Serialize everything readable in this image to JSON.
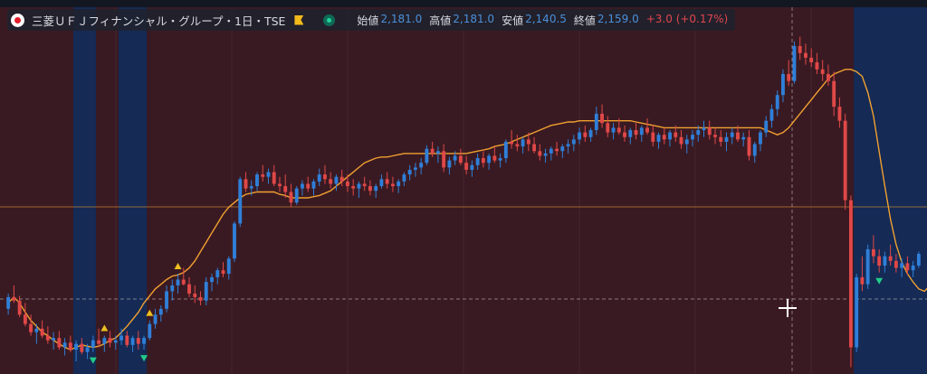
{
  "header": {
    "title": "三菱ＵＦＪフィナンシャル・グループ・1日・TSE",
    "open_label": "始値",
    "open_value": "2,181.0",
    "high_label": "高値",
    "high_value": "2,181.0",
    "low_label": "安値",
    "low_value": "2,140.5",
    "close_label": "終値",
    "close_value": "2,159.0",
    "change": "+3.0 (+0.17%)"
  },
  "colors": {
    "up": "#2f7fd8",
    "down": "#e04848",
    "ma": "#f0a030",
    "bg_red": "#3a1a22",
    "bg_blue": "#152a55",
    "buy_marker": "#f0c020",
    "sell_marker": "#22cc88"
  },
  "icons": [
    "logo-icon",
    "flag-icon",
    "status-dot-icon",
    "crosshair-icon"
  ],
  "chart_data": {
    "type": "candlestick",
    "y_range": [
      1940,
      2220
    ],
    "shading_blue_index_ranges": [
      [
        12,
        15
      ],
      [
        20,
        24
      ],
      [
        150,
        165
      ]
    ],
    "ma": [
      1990,
      1995,
      1990,
      1982,
      1975,
      1970,
      1965,
      1962,
      1958,
      1955,
      1952,
      1950,
      1952,
      1954,
      1953,
      1952,
      1953,
      1955,
      1958,
      1960,
      1965,
      1970,
      1976,
      1982,
      1990,
      1996,
      2002,
      2006,
      2010,
      2013,
      2014,
      2016,
      2020,
      2026,
      2034,
      2042,
      2050,
      2058,
      2066,
      2072,
      2076,
      2080,
      2083,
      2084,
      2085,
      2085,
      2085,
      2085,
      2083,
      2082,
      2080,
      2080,
      2080,
      2080,
      2081,
      2082,
      2084,
      2086,
      2090,
      2094,
      2098,
      2102,
      2106,
      2110,
      2112,
      2114,
      2115,
      2115,
      2116,
      2117,
      2118,
      2118,
      2118,
      2118,
      2118,
      2118,
      2118,
      2118,
      2118,
      2118,
      2118,
      2118,
      2119,
      2120,
      2121,
      2122,
      2124,
      2125,
      2126,
      2128,
      2130,
      2132,
      2134,
      2136,
      2138,
      2140,
      2142,
      2143,
      2144,
      2145,
      2145,
      2146,
      2146,
      2146,
      2146,
      2146,
      2146,
      2146,
      2146,
      2146,
      2146,
      2145,
      2144,
      2143,
      2142,
      2141,
      2140,
      2140,
      2140,
      2140,
      2140,
      2140,
      2140,
      2140,
      2140,
      2140,
      2140,
      2140,
      2140,
      2140,
      2140,
      2140,
      2140,
      2140,
      2138,
      2136,
      2134,
      2136,
      2140,
      2146,
      2152,
      2158,
      2164,
      2170,
      2176,
      2182,
      2186,
      2188,
      2190,
      2190,
      2188,
      2184,
      2170,
      2150,
      2120,
      2090,
      2062,
      2040,
      2025,
      2015,
      2008,
      2002,
      2000,
      2005,
      2012,
      2018
    ],
    "candles": [
      {
        "o": 1985,
        "h": 1998,
        "l": 1980,
        "c": 1995
      },
      {
        "o": 1995,
        "h": 2005,
        "l": 1990,
        "c": 1992
      },
      {
        "o": 1992,
        "h": 1996,
        "l": 1978,
        "c": 1980
      },
      {
        "o": 1980,
        "h": 1990,
        "l": 1970,
        "c": 1972
      },
      {
        "o": 1972,
        "h": 1980,
        "l": 1962,
        "c": 1965
      },
      {
        "o": 1965,
        "h": 1972,
        "l": 1955,
        "c": 1968
      },
      {
        "o": 1968,
        "h": 1975,
        "l": 1960,
        "c": 1962
      },
      {
        "o": 1962,
        "h": 1970,
        "l": 1955,
        "c": 1958
      },
      {
        "o": 1958,
        "h": 1965,
        "l": 1950,
        "c": 1960
      },
      {
        "o": 1960,
        "h": 1966,
        "l": 1950,
        "c": 1952
      },
      {
        "o": 1952,
        "h": 1960,
        "l": 1945,
        "c": 1956
      },
      {
        "o": 1956,
        "h": 1962,
        "l": 1948,
        "c": 1950
      },
      {
        "o": 1950,
        "h": 1958,
        "l": 1940,
        "c": 1955
      },
      {
        "o": 1955,
        "h": 1960,
        "l": 1946,
        "c": 1948
      },
      {
        "o": 1948,
        "h": 1955,
        "l": 1942,
        "c": 1952
      },
      {
        "o": 1952,
        "h": 1962,
        "l": 1948,
        "c": 1958
      },
      {
        "o": 1958,
        "h": 1968,
        "l": 1952,
        "c": 1955
      },
      {
        "o": 1955,
        "h": 1962,
        "l": 1948,
        "c": 1960
      },
      {
        "o": 1960,
        "h": 1966,
        "l": 1952,
        "c": 1956
      },
      {
        "o": 1956,
        "h": 1962,
        "l": 1950,
        "c": 1958
      },
      {
        "o": 1958,
        "h": 1968,
        "l": 1954,
        "c": 1962
      },
      {
        "o": 1962,
        "h": 1966,
        "l": 1952,
        "c": 1954
      },
      {
        "o": 1954,
        "h": 1962,
        "l": 1948,
        "c": 1960
      },
      {
        "o": 1960,
        "h": 1966,
        "l": 1950,
        "c": 1955
      },
      {
        "o": 1955,
        "h": 1962,
        "l": 1950,
        "c": 1960
      },
      {
        "o": 1960,
        "h": 1975,
        "l": 1958,
        "c": 1972
      },
      {
        "o": 1972,
        "h": 1985,
        "l": 1968,
        "c": 1980
      },
      {
        "o": 1980,
        "h": 1988,
        "l": 1974,
        "c": 1985
      },
      {
        "o": 1985,
        "h": 2005,
        "l": 1982,
        "c": 2000
      },
      {
        "o": 2000,
        "h": 2010,
        "l": 1992,
        "c": 2005
      },
      {
        "o": 2005,
        "h": 2015,
        "l": 1998,
        "c": 2010
      },
      {
        "o": 2010,
        "h": 2020,
        "l": 2005,
        "c": 2006
      },
      {
        "o": 2006,
        "h": 2012,
        "l": 1995,
        "c": 1998
      },
      {
        "o": 1998,
        "h": 2005,
        "l": 1990,
        "c": 1995
      },
      {
        "o": 1995,
        "h": 2000,
        "l": 1988,
        "c": 1992
      },
      {
        "o": 1992,
        "h": 2012,
        "l": 1988,
        "c": 2008
      },
      {
        "o": 2008,
        "h": 2015,
        "l": 2000,
        "c": 2012
      },
      {
        "o": 2012,
        "h": 2020,
        "l": 2006,
        "c": 2018
      },
      {
        "o": 2018,
        "h": 2025,
        "l": 2012,
        "c": 2015
      },
      {
        "o": 2015,
        "h": 2030,
        "l": 2010,
        "c": 2028
      },
      {
        "o": 2028,
        "h": 2060,
        "l": 2025,
        "c": 2058
      },
      {
        "o": 2058,
        "h": 2098,
        "l": 2055,
        "c": 2096
      },
      {
        "o": 2096,
        "h": 2102,
        "l": 2085,
        "c": 2088
      },
      {
        "o": 2088,
        "h": 2095,
        "l": 2082,
        "c": 2090
      },
      {
        "o": 2090,
        "h": 2102,
        "l": 2086,
        "c": 2100
      },
      {
        "o": 2100,
        "h": 2108,
        "l": 2094,
        "c": 2098
      },
      {
        "o": 2098,
        "h": 2105,
        "l": 2092,
        "c": 2102
      },
      {
        "o": 2102,
        "h": 2108,
        "l": 2090,
        "c": 2092
      },
      {
        "o": 2092,
        "h": 2098,
        "l": 2085,
        "c": 2090
      },
      {
        "o": 2090,
        "h": 2100,
        "l": 2080,
        "c": 2085
      },
      {
        "o": 2085,
        "h": 2092,
        "l": 2072,
        "c": 2076
      },
      {
        "o": 2076,
        "h": 2090,
        "l": 2074,
        "c": 2088
      },
      {
        "o": 2088,
        "h": 2095,
        "l": 2082,
        "c": 2092
      },
      {
        "o": 2092,
        "h": 2098,
        "l": 2085,
        "c": 2088
      },
      {
        "o": 2088,
        "h": 2096,
        "l": 2082,
        "c": 2094
      },
      {
        "o": 2094,
        "h": 2105,
        "l": 2090,
        "c": 2100
      },
      {
        "o": 2100,
        "h": 2108,
        "l": 2092,
        "c": 2096
      },
      {
        "o": 2096,
        "h": 2102,
        "l": 2088,
        "c": 2092
      },
      {
        "o": 2092,
        "h": 2100,
        "l": 2086,
        "c": 2098
      },
      {
        "o": 2098,
        "h": 2104,
        "l": 2090,
        "c": 2094
      },
      {
        "o": 2094,
        "h": 2100,
        "l": 2085,
        "c": 2090
      },
      {
        "o": 2090,
        "h": 2096,
        "l": 2082,
        "c": 2088
      },
      {
        "o": 2088,
        "h": 2094,
        "l": 2080,
        "c": 2092
      },
      {
        "o": 2092,
        "h": 2098,
        "l": 2086,
        "c": 2090
      },
      {
        "o": 2090,
        "h": 2095,
        "l": 2082,
        "c": 2086
      },
      {
        "o": 2086,
        "h": 2092,
        "l": 2080,
        "c": 2090
      },
      {
        "o": 2090,
        "h": 2100,
        "l": 2088,
        "c": 2096
      },
      {
        "o": 2096,
        "h": 2102,
        "l": 2088,
        "c": 2092
      },
      {
        "o": 2092,
        "h": 2098,
        "l": 2085,
        "c": 2090
      },
      {
        "o": 2090,
        "h": 2096,
        "l": 2084,
        "c": 2094
      },
      {
        "o": 2094,
        "h": 2102,
        "l": 2090,
        "c": 2100
      },
      {
        "o": 2100,
        "h": 2108,
        "l": 2095,
        "c": 2104
      },
      {
        "o": 2104,
        "h": 2110,
        "l": 2098,
        "c": 2106
      },
      {
        "o": 2106,
        "h": 2114,
        "l": 2100,
        "c": 2110
      },
      {
        "o": 2110,
        "h": 2125,
        "l": 2108,
        "c": 2122
      },
      {
        "o": 2122,
        "h": 2128,
        "l": 2115,
        "c": 2118
      },
      {
        "o": 2118,
        "h": 2124,
        "l": 2110,
        "c": 2120
      },
      {
        "o": 2120,
        "h": 2126,
        "l": 2102,
        "c": 2106
      },
      {
        "o": 2106,
        "h": 2115,
        "l": 2100,
        "c": 2112
      },
      {
        "o": 2112,
        "h": 2120,
        "l": 2108,
        "c": 2116
      },
      {
        "o": 2116,
        "h": 2122,
        "l": 2108,
        "c": 2110
      },
      {
        "o": 2110,
        "h": 2116,
        "l": 2100,
        "c": 2104
      },
      {
        "o": 2104,
        "h": 2112,
        "l": 2098,
        "c": 2108
      },
      {
        "o": 2108,
        "h": 2118,
        "l": 2104,
        "c": 2114
      },
      {
        "o": 2114,
        "h": 2120,
        "l": 2106,
        "c": 2110
      },
      {
        "o": 2110,
        "h": 2118,
        "l": 2104,
        "c": 2116
      },
      {
        "o": 2116,
        "h": 2124,
        "l": 2110,
        "c": 2112
      },
      {
        "o": 2112,
        "h": 2118,
        "l": 2106,
        "c": 2114
      },
      {
        "o": 2114,
        "h": 2130,
        "l": 2110,
        "c": 2128
      },
      {
        "o": 2128,
        "h": 2138,
        "l": 2122,
        "c": 2126
      },
      {
        "o": 2126,
        "h": 2134,
        "l": 2120,
        "c": 2124
      },
      {
        "o": 2124,
        "h": 2132,
        "l": 2118,
        "c": 2130
      },
      {
        "o": 2130,
        "h": 2136,
        "l": 2120,
        "c": 2126
      },
      {
        "o": 2126,
        "h": 2132,
        "l": 2118,
        "c": 2120
      },
      {
        "o": 2120,
        "h": 2126,
        "l": 2112,
        "c": 2116
      },
      {
        "o": 2116,
        "h": 2122,
        "l": 2110,
        "c": 2118
      },
      {
        "o": 2118,
        "h": 2124,
        "l": 2112,
        "c": 2122
      },
      {
        "o": 2122,
        "h": 2128,
        "l": 2116,
        "c": 2120
      },
      {
        "o": 2120,
        "h": 2126,
        "l": 2114,
        "c": 2124
      },
      {
        "o": 2124,
        "h": 2130,
        "l": 2118,
        "c": 2126
      },
      {
        "o": 2126,
        "h": 2134,
        "l": 2120,
        "c": 2130
      },
      {
        "o": 2130,
        "h": 2140,
        "l": 2126,
        "c": 2136
      },
      {
        "o": 2136,
        "h": 2142,
        "l": 2128,
        "c": 2132
      },
      {
        "o": 2132,
        "h": 2140,
        "l": 2128,
        "c": 2138
      },
      {
        "o": 2138,
        "h": 2158,
        "l": 2134,
        "c": 2152
      },
      {
        "o": 2152,
        "h": 2160,
        "l": 2140,
        "c": 2144
      },
      {
        "o": 2144,
        "h": 2150,
        "l": 2132,
        "c": 2136
      },
      {
        "o": 2136,
        "h": 2144,
        "l": 2130,
        "c": 2140
      },
      {
        "o": 2140,
        "h": 2148,
        "l": 2134,
        "c": 2136
      },
      {
        "o": 2136,
        "h": 2142,
        "l": 2128,
        "c": 2132
      },
      {
        "o": 2132,
        "h": 2140,
        "l": 2126,
        "c": 2138
      },
      {
        "o": 2138,
        "h": 2144,
        "l": 2130,
        "c": 2134
      },
      {
        "o": 2134,
        "h": 2142,
        "l": 2128,
        "c": 2140
      },
      {
        "o": 2140,
        "h": 2148,
        "l": 2134,
        "c": 2136
      },
      {
        "o": 2136,
        "h": 2142,
        "l": 2124,
        "c": 2128
      },
      {
        "o": 2128,
        "h": 2136,
        "l": 2122,
        "c": 2134
      },
      {
        "o": 2134,
        "h": 2140,
        "l": 2126,
        "c": 2130
      },
      {
        "o": 2130,
        "h": 2138,
        "l": 2124,
        "c": 2136
      },
      {
        "o": 2136,
        "h": 2142,
        "l": 2128,
        "c": 2132
      },
      {
        "o": 2132,
        "h": 2138,
        "l": 2122,
        "c": 2126
      },
      {
        "o": 2126,
        "h": 2134,
        "l": 2118,
        "c": 2130
      },
      {
        "o": 2130,
        "h": 2138,
        "l": 2124,
        "c": 2134
      },
      {
        "o": 2134,
        "h": 2142,
        "l": 2128,
        "c": 2138
      },
      {
        "o": 2138,
        "h": 2146,
        "l": 2132,
        "c": 2140
      },
      {
        "o": 2140,
        "h": 2146,
        "l": 2130,
        "c": 2134
      },
      {
        "o": 2134,
        "h": 2140,
        "l": 2126,
        "c": 2132
      },
      {
        "o": 2132,
        "h": 2138,
        "l": 2124,
        "c": 2128
      },
      {
        "o": 2128,
        "h": 2136,
        "l": 2120,
        "c": 2132
      },
      {
        "o": 2132,
        "h": 2140,
        "l": 2126,
        "c": 2136
      },
      {
        "o": 2136,
        "h": 2142,
        "l": 2128,
        "c": 2130
      },
      {
        "o": 2130,
        "h": 2136,
        "l": 2124,
        "c": 2132
      },
      {
        "o": 2132,
        "h": 2138,
        "l": 2112,
        "c": 2116
      },
      {
        "o": 2116,
        "h": 2128,
        "l": 2110,
        "c": 2126
      },
      {
        "o": 2126,
        "h": 2138,
        "l": 2120,
        "c": 2136
      },
      {
        "o": 2136,
        "h": 2150,
        "l": 2132,
        "c": 2146
      },
      {
        "o": 2146,
        "h": 2160,
        "l": 2140,
        "c": 2156
      },
      {
        "o": 2156,
        "h": 2172,
        "l": 2150,
        "c": 2168
      },
      {
        "o": 2168,
        "h": 2190,
        "l": 2162,
        "c": 2186
      },
      {
        "o": 2186,
        "h": 2198,
        "l": 2176,
        "c": 2180
      },
      {
        "o": 2180,
        "h": 2214,
        "l": 2178,
        "c": 2210
      },
      {
        "o": 2210,
        "h": 2218,
        "l": 2198,
        "c": 2204
      },
      {
        "o": 2204,
        "h": 2212,
        "l": 2194,
        "c": 2200
      },
      {
        "o": 2200,
        "h": 2208,
        "l": 2192,
        "c": 2196
      },
      {
        "o": 2196,
        "h": 2204,
        "l": 2186,
        "c": 2190
      },
      {
        "o": 2190,
        "h": 2198,
        "l": 2180,
        "c": 2186
      },
      {
        "o": 2186,
        "h": 2194,
        "l": 2176,
        "c": 2180
      },
      {
        "o": 2180,
        "h": 2188,
        "l": 2150,
        "c": 2158
      },
      {
        "o": 2158,
        "h": 2166,
        "l": 2140,
        "c": 2146
      },
      {
        "o": 2146,
        "h": 2152,
        "l": 2070,
        "c": 2078
      },
      {
        "o": 2078,
        "h": 2082,
        "l": 1935,
        "c": 1952
      },
      {
        "o": 1952,
        "h": 2015,
        "l": 1948,
        "c": 2012
      },
      {
        "o": 2012,
        "h": 2030,
        "l": 2000,
        "c": 2006
      },
      {
        "o": 2006,
        "h": 2040,
        "l": 2002,
        "c": 2036
      },
      {
        "o": 2036,
        "h": 2048,
        "l": 2024,
        "c": 2030
      },
      {
        "o": 2030,
        "h": 2036,
        "l": 2016,
        "c": 2022
      },
      {
        "o": 2022,
        "h": 2034,
        "l": 2016,
        "c": 2030
      },
      {
        "o": 2030,
        "h": 2040,
        "l": 2022,
        "c": 2026
      },
      {
        "o": 2026,
        "h": 2032,
        "l": 2016,
        "c": 2020
      },
      {
        "o": 2020,
        "h": 2028,
        "l": 2012,
        "c": 2024
      },
      {
        "o": 2024,
        "h": 2030,
        "l": 2014,
        "c": 2018
      },
      {
        "o": 2018,
        "h": 2026,
        "l": 2012,
        "c": 2022
      },
      {
        "o": 2022,
        "h": 2034,
        "l": 2020,
        "c": 2032
      }
    ],
    "buy_signals": [
      17,
      25,
      30
    ],
    "sell_signals": [
      15,
      24,
      154
    ]
  }
}
